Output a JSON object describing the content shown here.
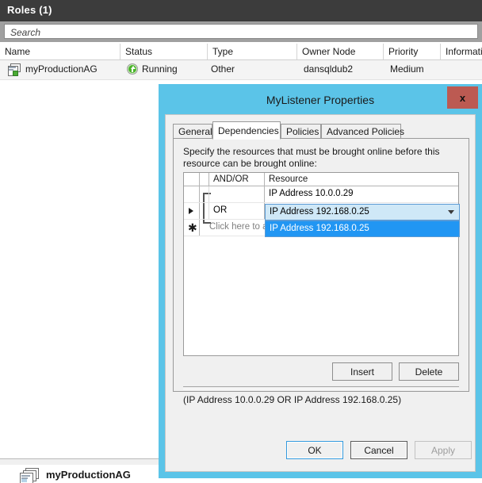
{
  "background": {
    "pane_title": "Roles (1)",
    "search": {
      "placeholder": "Search",
      "value": ""
    },
    "columns": [
      "Name",
      "Status",
      "Type",
      "Owner Node",
      "Priority",
      "Informatic"
    ],
    "rows": [
      {
        "name": "myProductionAG",
        "status": "Running",
        "type": "Other",
        "owner_node": "dansqldub2",
        "priority": "Medium",
        "information": ""
      }
    ],
    "bottom_pane_title": "myProductionAG",
    "status_icon": "green-up-arrow-icon",
    "role_icon": "role-resource-icon"
  },
  "dialog": {
    "title": "MyListener Properties",
    "close_label": "x",
    "close_color": "#bc5a52",
    "border_color": "#5bc4e8",
    "tabs": [
      {
        "label": "General",
        "active": false
      },
      {
        "label": "Dependencies",
        "active": true
      },
      {
        "label": "Policies",
        "active": false
      },
      {
        "label": "Advanced Policies",
        "active": false
      }
    ],
    "instruction": "Specify the resources that must be brought online before this resource can be brought online:",
    "grid": {
      "headers": [
        "",
        "",
        "AND/OR",
        "Resource"
      ],
      "rows": [
        {
          "marker": "",
          "and_or": "",
          "resource": "IP Address 10.0.0.29",
          "selected": false,
          "editing": false
        },
        {
          "marker": "▶",
          "and_or": "OR",
          "resource": "IP Address 192.168.0.25",
          "selected": true,
          "editing": true
        },
        {
          "marker": "✱",
          "and_or": "",
          "resource": "Click here to add a dependency",
          "selected": false,
          "editing": false
        }
      ],
      "dropdown": {
        "open": true,
        "value": "IP Address 192.168.0.25",
        "options": [
          {
            "label": "IP Address 192.168.0.25",
            "selected": true
          }
        ]
      }
    },
    "grid_buttons": [
      {
        "label": "Insert",
        "enabled": true
      },
      {
        "label": "Delete",
        "enabled": true
      }
    ],
    "expression": "(IP Address 10.0.0.29 OR IP Address 192.168.0.25)",
    "footer_buttons": [
      {
        "label": "OK",
        "enabled": true,
        "style": "default"
      },
      {
        "label": "Cancel",
        "enabled": true,
        "style": "focus"
      },
      {
        "label": "Apply",
        "enabled": false,
        "style": "normal"
      }
    ]
  }
}
